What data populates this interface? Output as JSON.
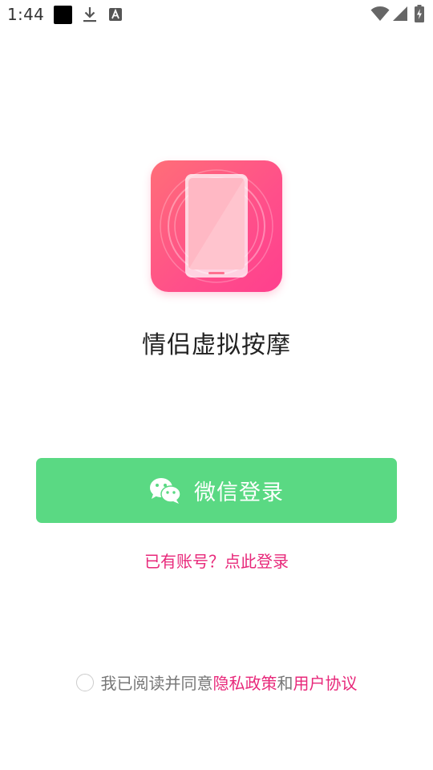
{
  "status_bar": {
    "time": "1:44",
    "icons": [
      "notification-square-icon",
      "download-icon",
      "a-badge-icon",
      "wifi-icon",
      "signal-icon",
      "battery-charging-icon"
    ]
  },
  "app": {
    "logo_icon": "phone-vibration-logo-icon",
    "title": "情侣虚拟按摩"
  },
  "login": {
    "wechat_icon": "wechat-icon",
    "wechat_label": "微信登录",
    "account_link": "已有账号？点此登录"
  },
  "agreement": {
    "prefix": "我已阅读并同意",
    "privacy_link": "隐私政策",
    "and": "和",
    "terms_link": "用户协议",
    "checked": false
  },
  "colors": {
    "wechat_green": "#5ad983",
    "accent_pink": "#e8287a",
    "logo_gradient_start": "#ff6e78",
    "logo_gradient_end": "#ff3f8e"
  }
}
